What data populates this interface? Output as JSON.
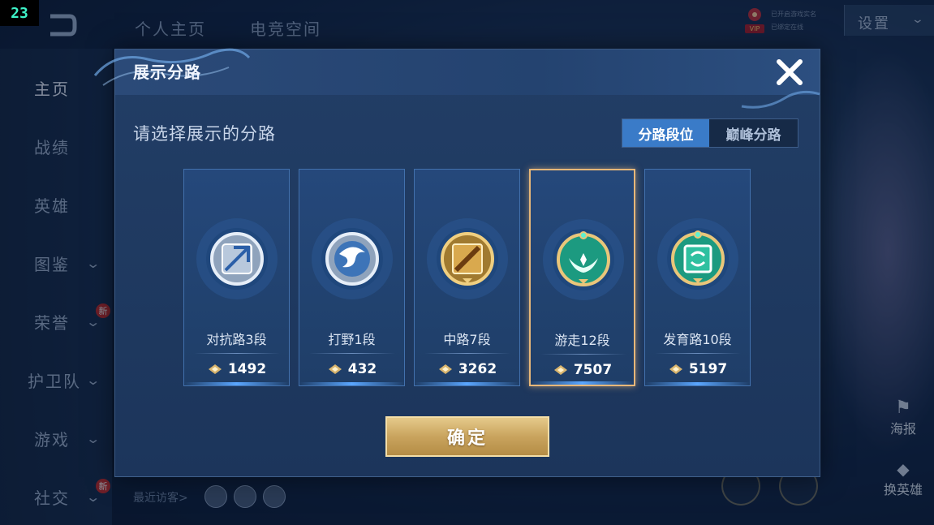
{
  "fps_counter": "23",
  "top_tabs": [
    "个人主页",
    "电竞空间"
  ],
  "vip": {
    "tag": "VIP",
    "line1": "已开启游戏实名",
    "line2": "已绑定在线"
  },
  "settings_label": "设置",
  "left_nav": [
    {
      "label": "主页",
      "active": true
    },
    {
      "label": "战绩"
    },
    {
      "label": "英雄"
    },
    {
      "label": "图鉴",
      "chevron": true
    },
    {
      "label": "荣誉",
      "chevron": true,
      "badge": "新"
    },
    {
      "label": "护卫队",
      "chevron": true
    },
    {
      "label": "游戏",
      "chevron": true
    },
    {
      "label": "社交",
      "chevron": true,
      "badge": "新"
    }
  ],
  "side_buttons": {
    "poster": "海报",
    "change_hero": "换英雄"
  },
  "recent_visitors_label": "最近访客>",
  "modal": {
    "title": "展示分路",
    "subtitle": "请选择展示的分路",
    "segments": [
      {
        "label": "分路段位",
        "active": true
      },
      {
        "label": "巅峰分路",
        "active": false
      }
    ],
    "cards": [
      {
        "name": "对抗路3段",
        "score": "1492",
        "icon": "clash-lane-badge-icon",
        "tier": "silver",
        "selected": false
      },
      {
        "name": "打野1段",
        "score": "432",
        "icon": "jungle-badge-icon",
        "tier": "silver",
        "selected": false
      },
      {
        "name": "中路7段",
        "score": "3262",
        "icon": "mid-lane-badge-icon",
        "tier": "gold",
        "selected": false
      },
      {
        "name": "游走12段",
        "score": "7507",
        "icon": "roam-badge-icon",
        "tier": "jade",
        "selected": true
      },
      {
        "name": "发育路10段",
        "score": "5197",
        "icon": "farm-lane-badge-icon",
        "tier": "jade",
        "selected": false
      }
    ],
    "confirm_label": "确定"
  },
  "colors": {
    "accent_blue": "#3a7bc8",
    "gold": "#e7b779",
    "panel": "#1c355b"
  }
}
